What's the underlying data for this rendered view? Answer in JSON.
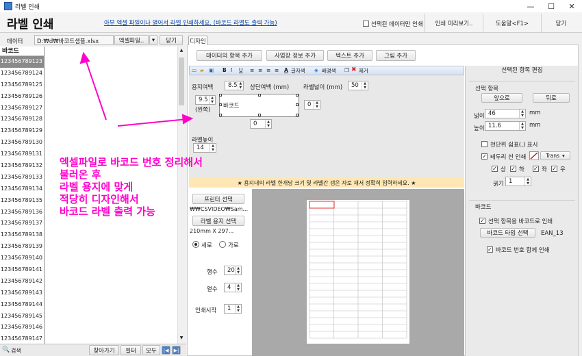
{
  "window": {
    "title": "라벨 인쇄",
    "controls": [
      "—",
      "☐",
      "✕"
    ]
  },
  "header": {
    "title": "라벨 인쇄",
    "hint": "아무 엑셀 파일이나 열어서 라벨 인쇄하세요. (바코드 라벨도 출력 가능)",
    "only_selected": "선택된 데이터만 인쇄",
    "preview_button": "인쇄 미리보기..",
    "help_button": "도움말<F1>",
    "close_button": "닫기"
  },
  "left": {
    "data_label": "데이터",
    "file_path": "D:₩d₩바코드샘플.xlsx",
    "excel_button": "엑셀파일..",
    "close_button": "닫기",
    "column_header": "바코드",
    "rows": [
      "123456789123",
      "123456789124",
      "123456789125",
      "123456789126",
      "123456789127",
      "123456789128",
      "123456789129",
      "123456789130",
      "123456789131",
      "123456789132",
      "123456789133",
      "123456789134",
      "123456789135",
      "123456789136",
      "123456789137",
      "123456789138",
      "123456789139",
      "123456789140",
      "123456789141",
      "123456789142",
      "123456789143",
      "123456789144",
      "123456789145",
      "123456789146",
      "123456789147"
    ],
    "selected_index": 0,
    "search_label": "검색",
    "find_button": "찾아가기",
    "filter_button": "필터",
    "all_button": "모두"
  },
  "design": {
    "tab": "디자인",
    "buttons": [
      "데이터의 항목 추가",
      "사업장 정보 추가",
      "텍스트 추가",
      "그림 추가"
    ],
    "toolbar": {
      "bold": "B",
      "italic": "I",
      "underline": "U",
      "font_color": "글자색",
      "bg_color": "배경색",
      "remove": "제거"
    },
    "margin_label": "용지여백",
    "margin_value": "8.5",
    "top_margin_label": "상단여백 (mm)",
    "label_width_label": "라벨넓이 (mm)",
    "label_width_value": "50",
    "left_value": "9.5",
    "left_label": "(왼쪽)",
    "right_value": "0",
    "bottom_value": "0",
    "barcode_text": "바코드",
    "label_height_label": "라벨높이",
    "label_height_value": "14",
    "notice": "★ 용지내의 라벨 한개당 크기 및 라벨간 갭은 자로 재서 정확히 입력하세요. ★",
    "printer_button": "프린터 선택",
    "printer_path": "₩₩CSVIDEO₩Sam...",
    "paper_button": "라벨 용지 선택",
    "paper_size": "210mm X 297...",
    "portrait": "세로",
    "landscape": "가로",
    "rows_label": "행수",
    "rows_value": "20",
    "cols_label": "열수",
    "cols_value": "4",
    "start_label": "인쇄시작",
    "start_value": "1"
  },
  "props": {
    "title": "선택된 항목 편집",
    "group": "선택 항목",
    "front_button": "앞으로",
    "back_button": "뒤로",
    "width_label": "넓이",
    "width_value": "46",
    "width_unit": "mm",
    "height_label": "높이",
    "height_value": "11.6",
    "height_unit": "mm",
    "thousands_label": "천단위 쉼표(,) 표시",
    "border_label": "테두리 선 인쇄",
    "border_color": "Trans",
    "top": "상",
    "bottom": "하",
    "left": "좌",
    "right": "우",
    "thickness_label": "굵기",
    "thickness_value": "1",
    "barcode_group": "바코드",
    "as_barcode": "선택 항목을 바코드로 인쇄",
    "type_button": "바코드 타입 선택",
    "type_value": "EAN_13",
    "print_number": "바코드 번호 함께 인쇄"
  },
  "annotation": {
    "lines": [
      "엑셀파일로 바코드 번호 정리해서",
      "불러온 후",
      "라벨 용지에 맞게",
      "적당히 디자인해서",
      "바코드 라벨 출력 가능"
    ],
    "color": "#ff00cc"
  }
}
